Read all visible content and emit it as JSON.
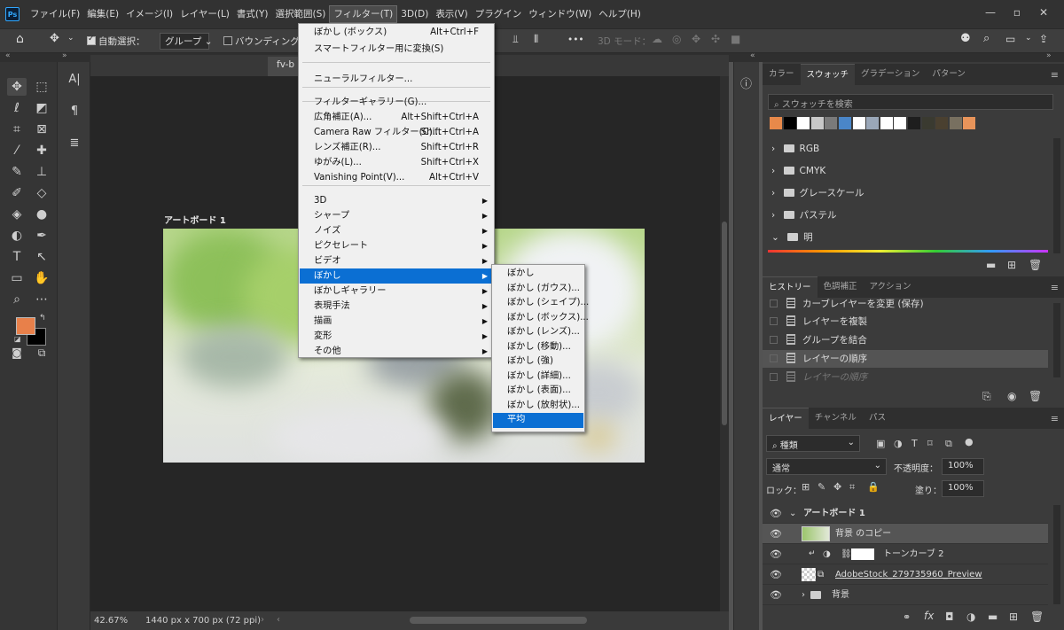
{
  "menubar": {
    "logo": "Ps",
    "items": [
      "ファイル(F)",
      "編集(E)",
      "イメージ(I)",
      "レイヤー(L)",
      "書式(Y)",
      "選択範囲(S)",
      "フィルター(T)",
      "3D(D)",
      "表示(V)",
      "プラグイン",
      "ウィンドウ(W)",
      "ヘルプ(H)"
    ],
    "active_index": 6,
    "window_buttons": [
      "—",
      "▫",
      "✕"
    ]
  },
  "options": {
    "auto_select_label": "自動選択：",
    "auto_select_value": "グループ",
    "bounding_label": "バウンディングボ",
    "mode_label": "3D モード：",
    "more": "•••"
  },
  "document": {
    "tab_label": "fv-b",
    "artboard_label": "アートボード 1",
    "zoom": "42.67%",
    "size": "1440 px x 700 px (72 ppi)"
  },
  "filter_menu": {
    "items": [
      {
        "label": "ぼかし (ボックス)",
        "shortcut": "Alt+Ctrl+F"
      },
      {
        "label": "スマートフィルター用に変換(S)",
        "shortcut": ""
      },
      {
        "label": "ニューラルフィルター...",
        "shortcut": ""
      },
      {
        "label": "フィルターギャラリー(G)...",
        "shortcut": ""
      },
      {
        "label": "広角補正(A)...",
        "shortcut": "Alt+Shift+Ctrl+A"
      },
      {
        "label": "Camera Raw フィルター(C)...",
        "shortcut": "Shift+Ctrl+A"
      },
      {
        "label": "レンズ補正(R)...",
        "shortcut": "Shift+Ctrl+R"
      },
      {
        "label": "ゆがみ(L)...",
        "shortcut": "Shift+Ctrl+X"
      },
      {
        "label": "Vanishing Point(V)...",
        "shortcut": "Alt+Ctrl+V"
      },
      {
        "label": "3D",
        "shortcut": ""
      },
      {
        "label": "シャープ",
        "shortcut": ""
      },
      {
        "label": "ノイズ",
        "shortcut": ""
      },
      {
        "label": "ピクセレート",
        "shortcut": ""
      },
      {
        "label": "ビデオ",
        "shortcut": ""
      },
      {
        "label": "ぼかし",
        "shortcut": ""
      },
      {
        "label": "ぼかしギャラリー",
        "shortcut": ""
      },
      {
        "label": "表現手法",
        "shortcut": ""
      },
      {
        "label": "描画",
        "shortcut": ""
      },
      {
        "label": "変形",
        "shortcut": ""
      },
      {
        "label": "その他",
        "shortcut": ""
      }
    ]
  },
  "blur_submenu": {
    "items": [
      "ぼかし",
      "ぼかし (ガウス)...",
      "ぼかし (シェイプ)...",
      "ぼかし (ボックス)...",
      "ぼかし (レンズ)...",
      "ぼかし (移動)...",
      "ぼかし (強)",
      "ぼかし (詳細)...",
      "ぼかし (表面)...",
      "ぼかし (放射状)...",
      "平均"
    ],
    "highlighted_index": 10
  },
  "swatches_panel": {
    "tabs": [
      "カラー",
      "スウォッチ",
      "グラデーション",
      "パターン"
    ],
    "active_tab": 1,
    "search_placeholder": "スウォッチを検索",
    "swatch_colors": [
      "#e8894a",
      "#000000",
      "#ffffff",
      "#c8c8c8",
      "#7a7a7a",
      "#4a86c8",
      "#ffffff",
      "#9aa7b8",
      "#ffffff",
      "#ffffff",
      "#1e1e1e",
      "#3a3a30",
      "#4a4030",
      "#787060",
      "#e8945a"
    ],
    "folders": [
      "RGB",
      "CMYK",
      "グレースケール",
      "パステル",
      "明"
    ]
  },
  "history_panel": {
    "tabs": [
      "ヒストリー",
      "色調補正",
      "アクション"
    ],
    "active_tab": 0,
    "items": [
      "カーブレイヤーを変更 (保存)",
      "レイヤーを複製",
      "グループを結合",
      "レイヤーの順序",
      "レイヤーの順序"
    ]
  },
  "layers_panel": {
    "tabs": [
      "レイヤー",
      "チャンネル",
      "パス"
    ],
    "active_tab": 0,
    "kind_label": "種類",
    "blend_mode": "通常",
    "opacity_label": "不透明度：",
    "opacity_value": "100%",
    "lock_label": "ロック：",
    "fill_label": "塗り：",
    "fill_value": "100%",
    "layers": [
      "アートボード 1",
      "背景 のコピー",
      "トーンカーブ 2",
      "AdobeStock_279735960_Preview",
      "背景"
    ]
  }
}
